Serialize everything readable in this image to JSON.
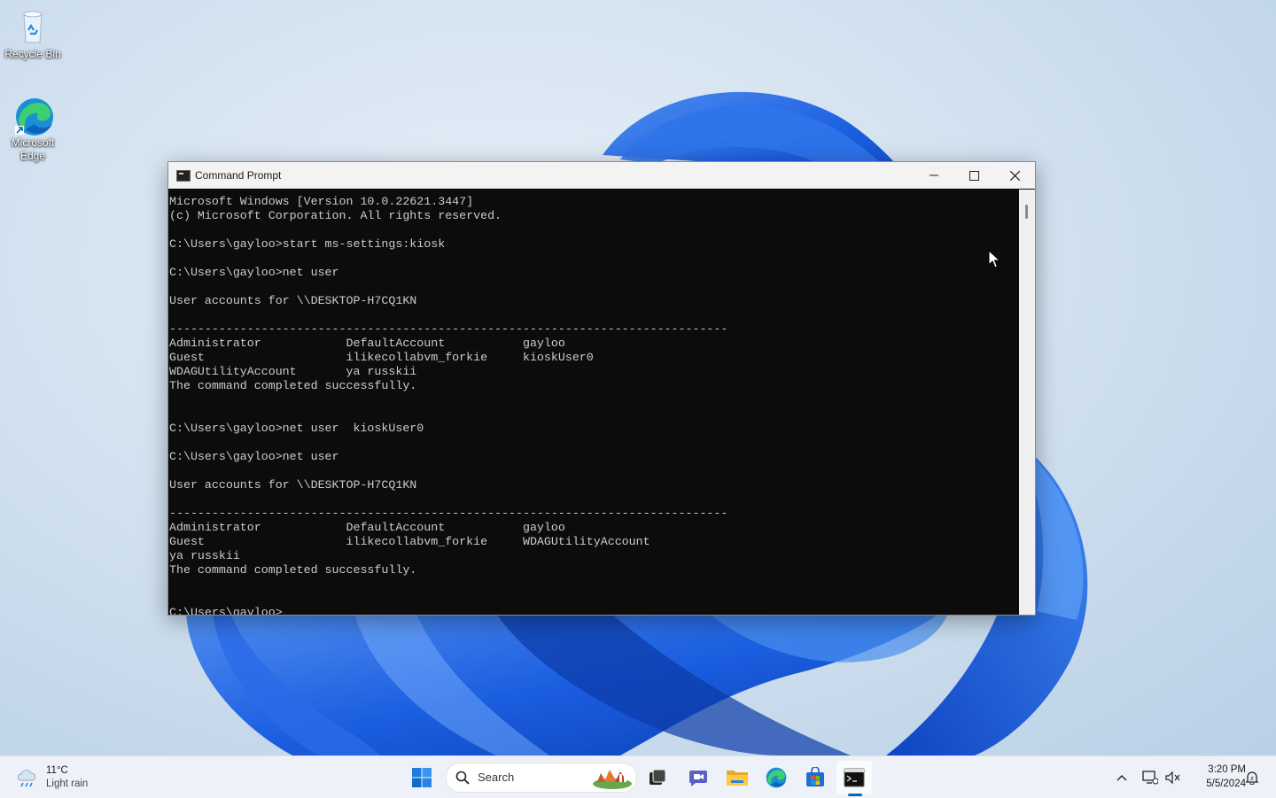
{
  "desktop": {
    "icons": [
      {
        "label": "Recycle Bin",
        "icon": "recycle-bin-icon"
      },
      {
        "label": "Microsoft Edge",
        "icon": "edge-icon"
      }
    ]
  },
  "window": {
    "title": "Command Prompt",
    "app_icon": "cmd-icon",
    "controls": {
      "minimize": "minimize-icon",
      "maximize": "maximize-icon",
      "close": "close-icon"
    },
    "console_lines": [
      "Microsoft Windows [Version 10.0.22621.3447]",
      "(c) Microsoft Corporation. All rights reserved.",
      "",
      "C:\\Users\\gayloo>start ms-settings:kiosk",
      "",
      "C:\\Users\\gayloo>net user",
      "",
      "User accounts for \\\\DESKTOP-H7CQ1KN",
      "",
      "-------------------------------------------------------------------------------",
      "Administrator            DefaultAccount           gayloo",
      "Guest                    ilikecollabvm_forkie     kioskUser0",
      "WDAGUtilityAccount       ya russkii",
      "The command completed successfully.",
      "",
      "",
      "C:\\Users\\gayloo>net user  kioskUser0",
      "",
      "C:\\Users\\gayloo>net user",
      "",
      "User accounts for \\\\DESKTOP-H7CQ1KN",
      "",
      "-------------------------------------------------------------------------------",
      "Administrator            DefaultAccount           gayloo",
      "Guest                    ilikecollabvm_forkie     WDAGUtilityAccount",
      "ya russkii",
      "The command completed successfully.",
      "",
      "",
      "C:\\Users\\gayloo>"
    ],
    "colors": {
      "console_bg": "#0c0c0c",
      "console_fg": "#cccccc",
      "titlebar": "#f3f3f3"
    }
  },
  "taskbar": {
    "weather": {
      "temp": "11°C",
      "condition": "Light rain",
      "icon": "cloud-rain-icon"
    },
    "search_placeholder": "Search",
    "pinned": [
      "start-icon",
      "search-icon",
      "task-view-icon",
      "chat-icon",
      "file-explorer-icon",
      "edge-icon",
      "store-icon",
      "terminal-icon"
    ],
    "tray": [
      "chevron-up-icon",
      "network-icon",
      "volume-icon",
      "notification-icon"
    ],
    "clock": {
      "time": "3:20 PM",
      "date": "5/5/2024"
    },
    "accent": "#0067c0"
  }
}
